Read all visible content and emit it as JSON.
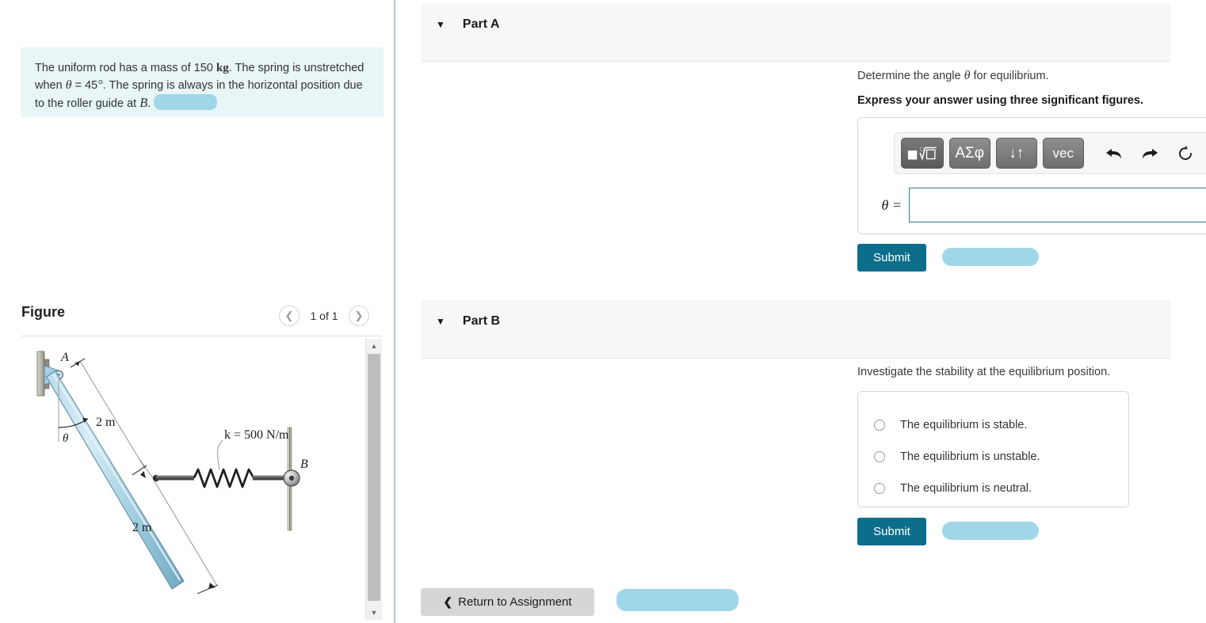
{
  "problem": {
    "text_1": "The uniform rod has a mass of 150",
    "unit_mass": "kg",
    "text_2": ". The spring is unstretched when",
    "theta_symbol": "θ",
    "text_3": "= 45",
    "degree": "°",
    "text_4": ". The spring is always in the horizontal position due to the roller guide at",
    "point_b": "B",
    "text_5": "."
  },
  "figure": {
    "title": "Figure",
    "counter": "1 of 1",
    "prev_icon": "chevron-left-icon",
    "next_icon": "chevron-right-icon",
    "scroll_up_icon": "▲",
    "scroll_down_icon": "▼",
    "labels": {
      "point_a": "A",
      "point_b": "B",
      "theta": "θ",
      "length_upper": "2 m",
      "length_lower": "2 m",
      "spring": "k = 500 N/m"
    }
  },
  "part_a": {
    "caret": "▼",
    "title": "Part A",
    "prompt_pre": "Determine the angle",
    "prompt_var": "θ",
    "prompt_post": "for equilibrium.",
    "instruction": "Express your answer using three significant figures.",
    "toolbar": {
      "template_label": "■√□",
      "greek_label": "ΑΣφ",
      "script_label": "↓↑",
      "vector_label": "vec",
      "undo_label": "↶",
      "redo_label": "↷",
      "reset_label": "↺",
      "keyboard_label": "⌨",
      "help_label": "?"
    },
    "answer_label": "θ =",
    "answer_value": "",
    "answer_placeholder": "",
    "answer_unit": "°",
    "submit_label": "Submit"
  },
  "part_b": {
    "caret": "▼",
    "title": "Part B",
    "prompt": "Investigate the stability at the equilibrium position.",
    "choices": [
      "The equilibrium is stable.",
      "The equilibrium is unstable.",
      "The equilibrium is neutral."
    ],
    "submit_label": "Submit"
  },
  "footer": {
    "return_label": "Return to Assignment",
    "return_icon": "chevron-left-icon"
  }
}
